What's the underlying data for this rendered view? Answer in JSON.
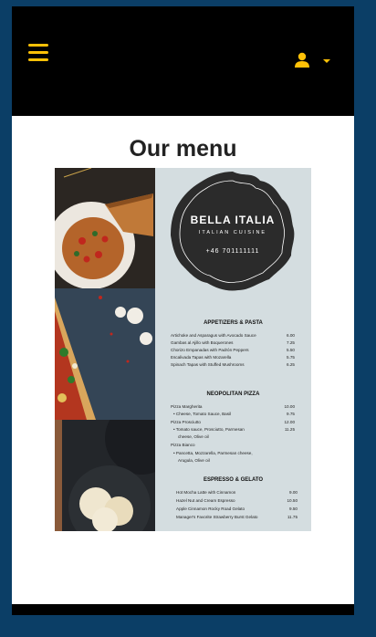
{
  "header": {
    "menu_icon": "hamburger-icon",
    "user_icon": "user-icon",
    "dropdown_icon": "caret-down-icon",
    "accent_color": "#ffc107"
  },
  "page": {
    "title": "Our menu"
  },
  "menu_card": {
    "brand": "BELLA ITALIA",
    "subtitle": "ITALIAN CUISINE",
    "phone": "+46 701111111",
    "sections": [
      {
        "title": "APPETIZERS & PASTA",
        "items": [
          {
            "name": "Artichoke and Asparagus with Avocado Sauce",
            "price": "6.00"
          },
          {
            "name": "Gambas al Ajillo with Boquerones",
            "price": "7.25"
          },
          {
            "name": "Chorizo Empanadas with Padrón Peppers",
            "price": "5.50"
          },
          {
            "name": "Escalivada Tapas with Mozarella",
            "price": "5.75"
          },
          {
            "name": "Spinach Tapas with Stuffed Mushrooms",
            "price": "6.25"
          }
        ]
      },
      {
        "title": "NEOPOLITAN PIZZA",
        "lines": [
          {
            "text": "Pizza Margherita",
            "price": "10.00"
          },
          {
            "text": "• Cheese, Tomato Sauce, Basil",
            "price": "9.75"
          },
          {
            "text": "Pizza Prosciutto",
            "price": "12.00"
          },
          {
            "text": "• Tomato sauce, Prosciutto, Parmesan",
            "price": "11.25"
          },
          {
            "text": "cheese, Olive oil",
            "price": ""
          },
          {
            "text": "Pizza Bianco",
            "price": ""
          },
          {
            "text": "• Pancetta, Mozzarella, Parmesan cheese,",
            "price": ""
          },
          {
            "text": "Arugula, Olive oil",
            "price": ""
          }
        ]
      },
      {
        "title": "ESPRESSO & GELATO",
        "items": [
          {
            "name": "Hot Mocha Latte with Cinnamon",
            "price": "9.00"
          },
          {
            "name": "Hazel Nut and Cream Espresso",
            "price": "10.50"
          },
          {
            "name": "Apple Cinnamon Rocky Road Gelato",
            "price": "9.50"
          },
          {
            "name": "Manager's Favorite Strawberry Burst Gelato",
            "price": "11.75"
          }
        ]
      }
    ]
  }
}
